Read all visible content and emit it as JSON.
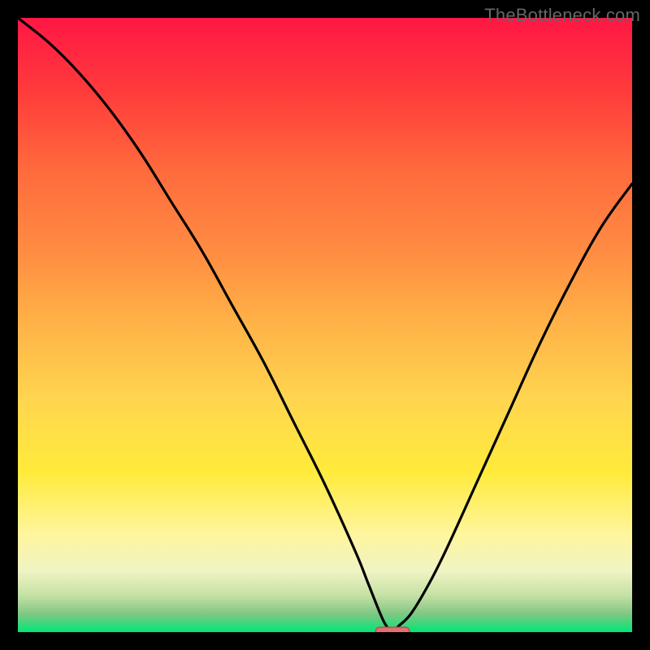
{
  "watermark": "TheBottleneck.com",
  "chart_data": {
    "type": "line",
    "title": "",
    "xlabel": "",
    "ylabel": "",
    "xlim": [
      0,
      100
    ],
    "ylim": [
      0,
      100
    ],
    "grid": false,
    "legend": false,
    "background_gradient": {
      "stops": [
        {
          "offset": 0.0,
          "color": "#FF1744"
        },
        {
          "offset": 0.12,
          "color": "#FF3B3B"
        },
        {
          "offset": 0.25,
          "color": "#FF6B3D"
        },
        {
          "offset": 0.38,
          "color": "#FF8C42"
        },
        {
          "offset": 0.5,
          "color": "#FFB347"
        },
        {
          "offset": 0.62,
          "color": "#FFD54F"
        },
        {
          "offset": 0.74,
          "color": "#FFEB3B"
        },
        {
          "offset": 0.84,
          "color": "#FFF59D"
        },
        {
          "offset": 0.9,
          "color": "#F0F4C3"
        },
        {
          "offset": 0.94,
          "color": "#C5E1A5"
        },
        {
          "offset": 0.97,
          "color": "#81C784"
        },
        {
          "offset": 1.0,
          "color": "#00E676"
        }
      ]
    },
    "series": [
      {
        "name": "bottleneck-curve",
        "color": "#000000",
        "x": [
          0,
          5,
          10,
          15,
          20,
          25,
          30,
          35,
          40,
          45,
          50,
          55,
          57,
          59,
          60,
          61,
          62,
          64,
          67,
          70,
          75,
          80,
          85,
          90,
          95,
          100
        ],
        "y": [
          100,
          96,
          91,
          85,
          78,
          70,
          62,
          53,
          44,
          34,
          24,
          13,
          8,
          3,
          1,
          0,
          1,
          3,
          8,
          14,
          25,
          36,
          47,
          57,
          66,
          73
        ]
      }
    ],
    "marker": {
      "name": "optimal-point",
      "x": 61,
      "y": 0,
      "shape": "rounded-rect",
      "fill": "#E27070",
      "stroke": "#B85050",
      "width_pct": 5.5,
      "height_pct": 1.6
    }
  }
}
